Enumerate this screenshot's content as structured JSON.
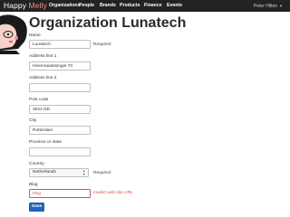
{
  "navbar": {
    "brand_happy": "Happy",
    "brand_melly": "Melly",
    "items": [
      {
        "label": "Organizations"
      },
      {
        "label": "People"
      },
      {
        "label": "Brands"
      },
      {
        "label": "Products"
      },
      {
        "label": "Finance"
      },
      {
        "label": "Events"
      }
    ],
    "user": "Peter Hilton"
  },
  "page": {
    "title": "Organization Lunatech"
  },
  "form": {
    "name": {
      "label": "Name",
      "value": "Lunatech",
      "help": "Required"
    },
    "address1": {
      "label": "Address line 1",
      "value": "Heemraadssingel 70"
    },
    "address2": {
      "label": "Address line 2",
      "value": ""
    },
    "postcode": {
      "label": "Post code",
      "value": "3021 DD"
    },
    "city": {
      "label": "City",
      "value": "Rotterdam"
    },
    "province": {
      "label": "Province or state",
      "value": ""
    },
    "country": {
      "label": "Country",
      "selected": "Netherlands",
      "help": "Required"
    },
    "blog": {
      "label": "Blog",
      "value": "blog",
      "help": "Invalid web site URL"
    },
    "save_label": "Save"
  },
  "colors": {
    "navbar_bg": "#222222",
    "brand_accent": "#ff8a80",
    "error": "#d9534f",
    "primary_button": "#2266bb"
  },
  "icons": {
    "avatar": "woman-illustration-icon",
    "select_arrows": "up-down-arrows-icon",
    "user_caret": "caret-down-icon"
  }
}
